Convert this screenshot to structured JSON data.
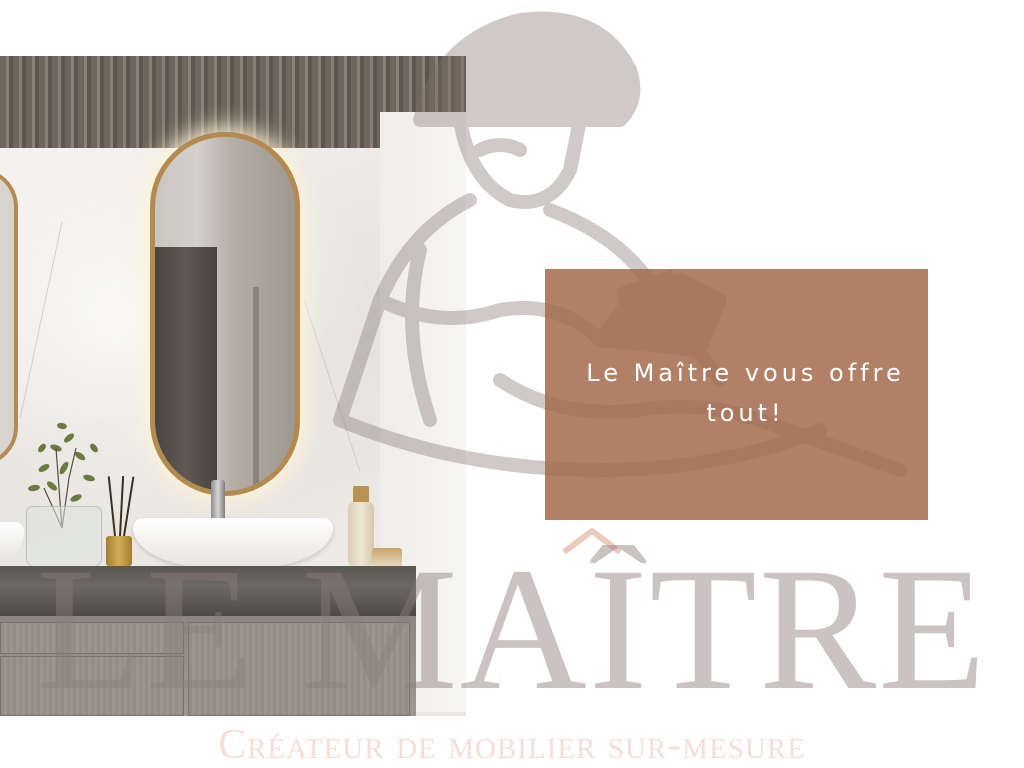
{
  "promo": {
    "headline": "Le Maître vous offre tout!"
  },
  "brand": {
    "wordmark": "LE MAÎTRE",
    "tagline": "Créateur de mobilier sur-mesure"
  },
  "photo": {
    "subject": "bathroom-vanity-photo"
  },
  "colors": {
    "promo_background": "#A36A4C",
    "mirror_frame": "#B58A4F",
    "watermark": "#8C7D78",
    "tagline": "#D6967D"
  }
}
